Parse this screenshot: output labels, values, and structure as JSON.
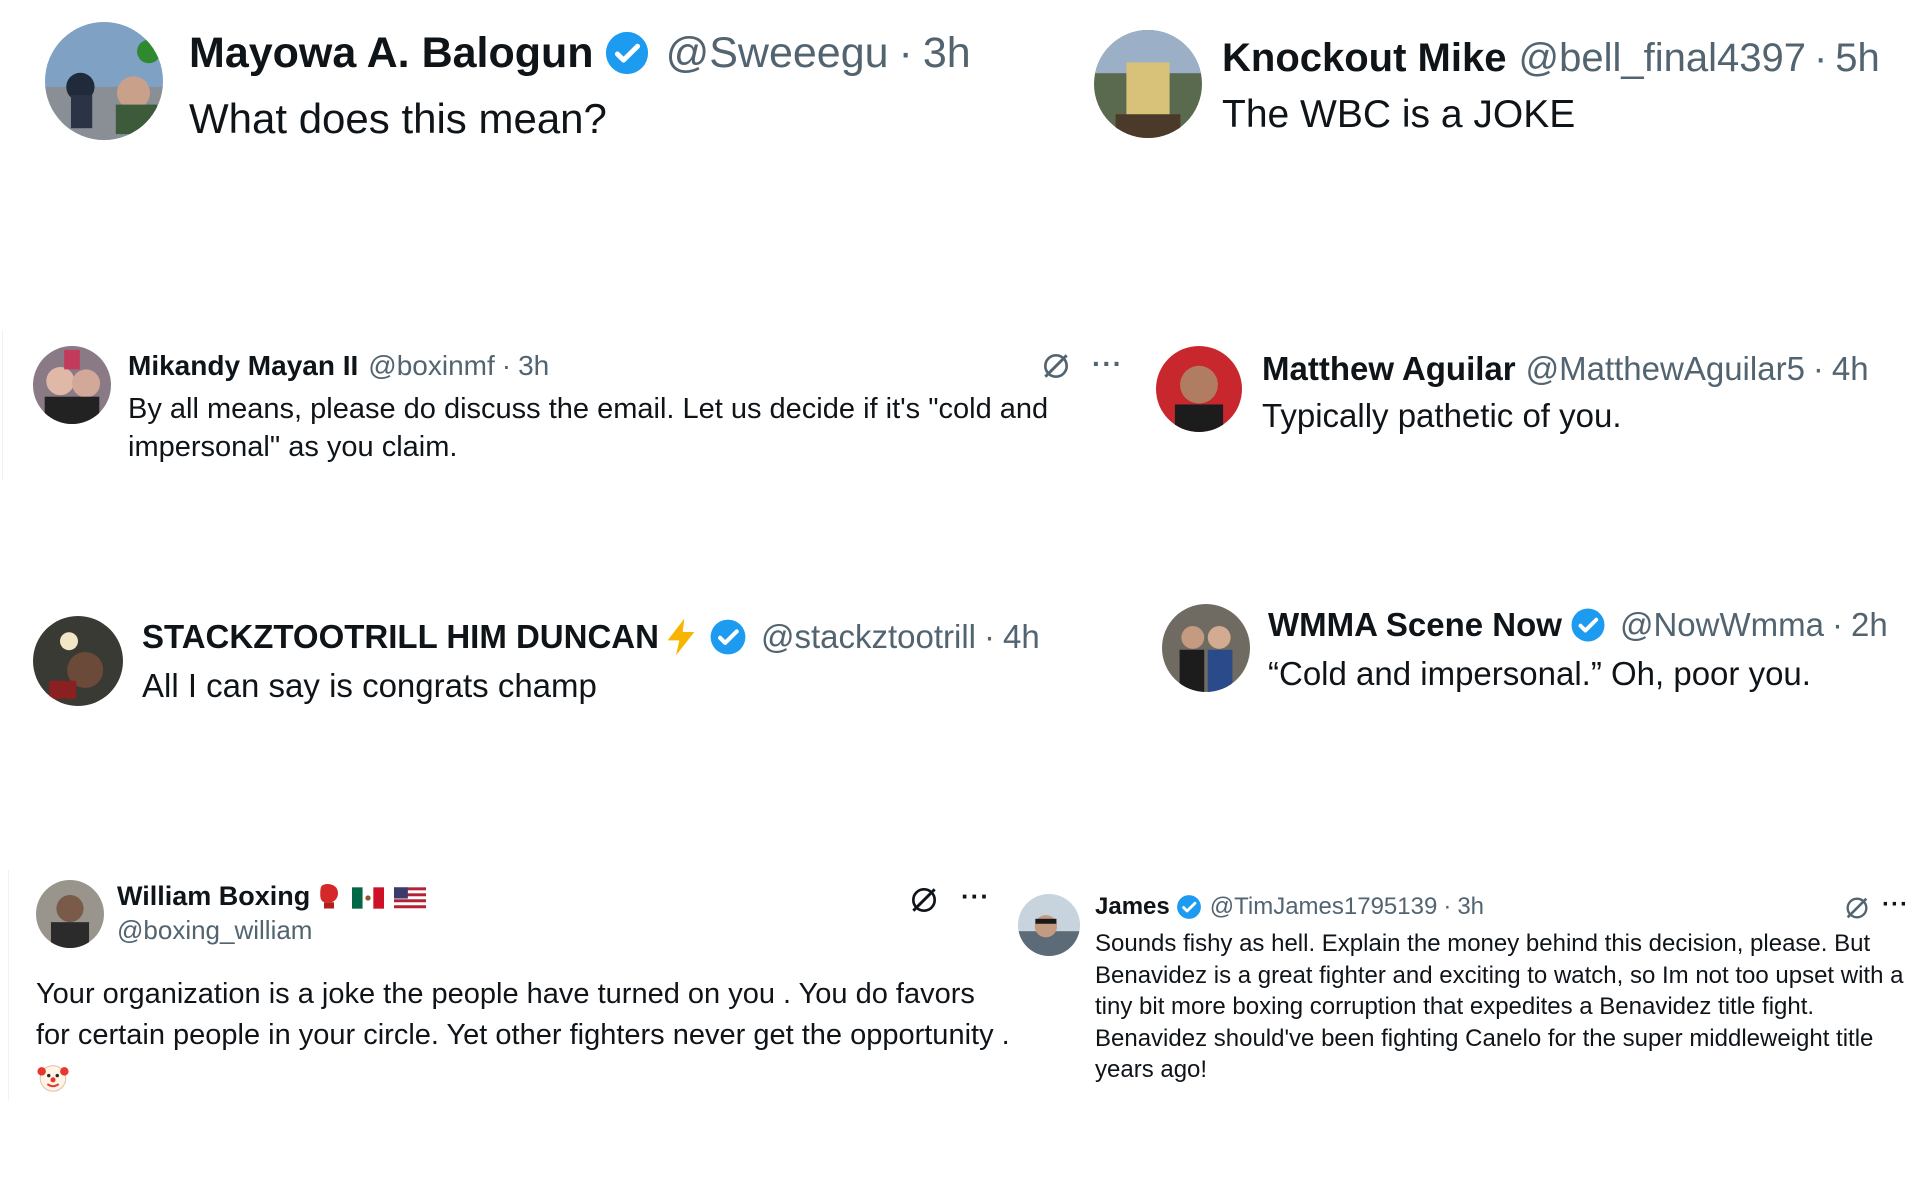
{
  "tweets": [
    {
      "name": "Mayowa A. Balogun",
      "verified": true,
      "handle": "@Sweeegu",
      "sep": "·",
      "time": "3h",
      "text": "What does this mean?"
    },
    {
      "name": "Knockout Mike",
      "verified": false,
      "handle": "@bell_final4397",
      "sep": "·",
      "time": "5h",
      "text": "The WBC is a JOKE"
    },
    {
      "name": "Mikandy Mayan II",
      "verified": false,
      "handle": "@boxinmf",
      "sep": "·",
      "time": "3h",
      "text": "By all means, please do discuss the email. Let us decide if it's \"cold and impersonal\" as you claim."
    },
    {
      "name": "Matthew Aguilar",
      "verified": false,
      "handle": "@MatthewAguilar5",
      "sep": "·",
      "time": "4h",
      "text": "Typically pathetic of you."
    },
    {
      "name": "STACKZTOOTRILL HIM DUNCAN",
      "verified": true,
      "handle": "@stackztootrill",
      "sep": "·",
      "time": "4h",
      "text": "All I can say is congrats champ",
      "emoji": "⚡"
    },
    {
      "name": "WMMA Scene Now",
      "verified": true,
      "handle": "@NowWmma",
      "sep": "·",
      "time": "2h",
      "text": "“Cold and impersonal.” Oh, poor you."
    },
    {
      "name": "William Boxing",
      "verified": false,
      "handle": "@boxing_william",
      "text": "Your organization is a joke the people have turned on you . You do favors for certain people in your circle. Yet other fighters never get the opportunity .",
      "emoji_text": "🤡",
      "flag_emojis": [
        "🥊",
        "🇲🇽",
        "🇺🇸"
      ]
    },
    {
      "name": "James",
      "verified": true,
      "handle": "@TimJames1795139",
      "sep": "·",
      "time": "3h",
      "text": "Sounds fishy as hell. Explain the money behind this decision, please. But Benavidez is a great fighter and exciting to watch, so Im not too upset with a tiny bit more boxing corruption  that expedites a Benavidez title fight. Benavidez should've been fighting Canelo for the super middleweight title years ago!"
    }
  ],
  "more_label": "···",
  "colors": {
    "verified": "#1d9bf0",
    "muted": "#536471",
    "text": "#0f1419",
    "bolt": "#f7b500"
  }
}
